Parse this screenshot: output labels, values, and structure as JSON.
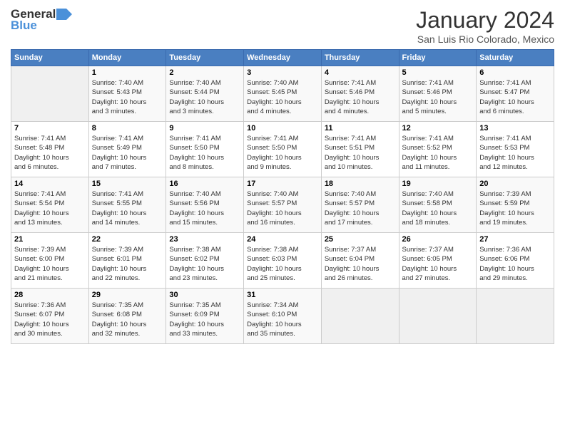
{
  "header": {
    "logo_general": "General",
    "logo_blue": "Blue",
    "main_title": "January 2024",
    "subtitle": "San Luis Rio Colorado, Mexico"
  },
  "calendar": {
    "days_of_week": [
      "Sunday",
      "Monday",
      "Tuesday",
      "Wednesday",
      "Thursday",
      "Friday",
      "Saturday"
    ],
    "weeks": [
      [
        {
          "day": "",
          "info": ""
        },
        {
          "day": "1",
          "info": "Sunrise: 7:40 AM\nSunset: 5:43 PM\nDaylight: 10 hours\nand 3 minutes."
        },
        {
          "day": "2",
          "info": "Sunrise: 7:40 AM\nSunset: 5:44 PM\nDaylight: 10 hours\nand 3 minutes."
        },
        {
          "day": "3",
          "info": "Sunrise: 7:40 AM\nSunset: 5:45 PM\nDaylight: 10 hours\nand 4 minutes."
        },
        {
          "day": "4",
          "info": "Sunrise: 7:41 AM\nSunset: 5:46 PM\nDaylight: 10 hours\nand 4 minutes."
        },
        {
          "day": "5",
          "info": "Sunrise: 7:41 AM\nSunset: 5:46 PM\nDaylight: 10 hours\nand 5 minutes."
        },
        {
          "day": "6",
          "info": "Sunrise: 7:41 AM\nSunset: 5:47 PM\nDaylight: 10 hours\nand 6 minutes."
        }
      ],
      [
        {
          "day": "7",
          "info": "Sunrise: 7:41 AM\nSunset: 5:48 PM\nDaylight: 10 hours\nand 6 minutes."
        },
        {
          "day": "8",
          "info": "Sunrise: 7:41 AM\nSunset: 5:49 PM\nDaylight: 10 hours\nand 7 minutes."
        },
        {
          "day": "9",
          "info": "Sunrise: 7:41 AM\nSunset: 5:50 PM\nDaylight: 10 hours\nand 8 minutes."
        },
        {
          "day": "10",
          "info": "Sunrise: 7:41 AM\nSunset: 5:50 PM\nDaylight: 10 hours\nand 9 minutes."
        },
        {
          "day": "11",
          "info": "Sunrise: 7:41 AM\nSunset: 5:51 PM\nDaylight: 10 hours\nand 10 minutes."
        },
        {
          "day": "12",
          "info": "Sunrise: 7:41 AM\nSunset: 5:52 PM\nDaylight: 10 hours\nand 11 minutes."
        },
        {
          "day": "13",
          "info": "Sunrise: 7:41 AM\nSunset: 5:53 PM\nDaylight: 10 hours\nand 12 minutes."
        }
      ],
      [
        {
          "day": "14",
          "info": "Sunrise: 7:41 AM\nSunset: 5:54 PM\nDaylight: 10 hours\nand 13 minutes."
        },
        {
          "day": "15",
          "info": "Sunrise: 7:41 AM\nSunset: 5:55 PM\nDaylight: 10 hours\nand 14 minutes."
        },
        {
          "day": "16",
          "info": "Sunrise: 7:40 AM\nSunset: 5:56 PM\nDaylight: 10 hours\nand 15 minutes."
        },
        {
          "day": "17",
          "info": "Sunrise: 7:40 AM\nSunset: 5:57 PM\nDaylight: 10 hours\nand 16 minutes."
        },
        {
          "day": "18",
          "info": "Sunrise: 7:40 AM\nSunset: 5:57 PM\nDaylight: 10 hours\nand 17 minutes."
        },
        {
          "day": "19",
          "info": "Sunrise: 7:40 AM\nSunset: 5:58 PM\nDaylight: 10 hours\nand 18 minutes."
        },
        {
          "day": "20",
          "info": "Sunrise: 7:39 AM\nSunset: 5:59 PM\nDaylight: 10 hours\nand 19 minutes."
        }
      ],
      [
        {
          "day": "21",
          "info": "Sunrise: 7:39 AM\nSunset: 6:00 PM\nDaylight: 10 hours\nand 21 minutes."
        },
        {
          "day": "22",
          "info": "Sunrise: 7:39 AM\nSunset: 6:01 PM\nDaylight: 10 hours\nand 22 minutes."
        },
        {
          "day": "23",
          "info": "Sunrise: 7:38 AM\nSunset: 6:02 PM\nDaylight: 10 hours\nand 23 minutes."
        },
        {
          "day": "24",
          "info": "Sunrise: 7:38 AM\nSunset: 6:03 PM\nDaylight: 10 hours\nand 25 minutes."
        },
        {
          "day": "25",
          "info": "Sunrise: 7:37 AM\nSunset: 6:04 PM\nDaylight: 10 hours\nand 26 minutes."
        },
        {
          "day": "26",
          "info": "Sunrise: 7:37 AM\nSunset: 6:05 PM\nDaylight: 10 hours\nand 27 minutes."
        },
        {
          "day": "27",
          "info": "Sunrise: 7:36 AM\nSunset: 6:06 PM\nDaylight: 10 hours\nand 29 minutes."
        }
      ],
      [
        {
          "day": "28",
          "info": "Sunrise: 7:36 AM\nSunset: 6:07 PM\nDaylight: 10 hours\nand 30 minutes."
        },
        {
          "day": "29",
          "info": "Sunrise: 7:35 AM\nSunset: 6:08 PM\nDaylight: 10 hours\nand 32 minutes."
        },
        {
          "day": "30",
          "info": "Sunrise: 7:35 AM\nSunset: 6:09 PM\nDaylight: 10 hours\nand 33 minutes."
        },
        {
          "day": "31",
          "info": "Sunrise: 7:34 AM\nSunset: 6:10 PM\nDaylight: 10 hours\nand 35 minutes."
        },
        {
          "day": "",
          "info": ""
        },
        {
          "day": "",
          "info": ""
        },
        {
          "day": "",
          "info": ""
        }
      ]
    ]
  }
}
